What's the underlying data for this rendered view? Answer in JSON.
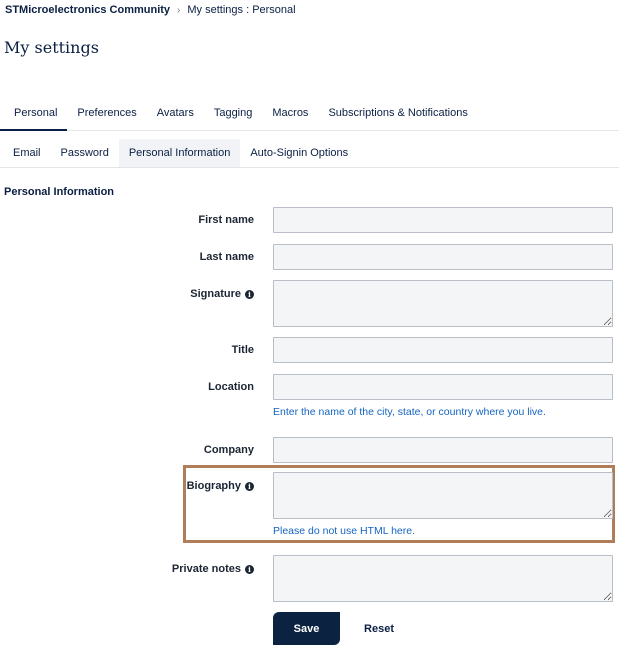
{
  "breadcrumb": {
    "root": "STMicroelectronics Community",
    "separator": "›",
    "current": "My settings : Personal"
  },
  "page_title": "My settings",
  "main_tabs": [
    {
      "label": "Personal",
      "active": true
    },
    {
      "label": "Preferences",
      "active": false
    },
    {
      "label": "Avatars",
      "active": false
    },
    {
      "label": "Tagging",
      "active": false
    },
    {
      "label": "Macros",
      "active": false
    },
    {
      "label": "Subscriptions & Notifications",
      "active": false
    }
  ],
  "sub_tabs": [
    {
      "label": "Email",
      "active": false
    },
    {
      "label": "Password",
      "active": false
    },
    {
      "label": "Personal Information",
      "active": true
    },
    {
      "label": "Auto-Signin Options",
      "active": false
    }
  ],
  "section_title": "Personal Information",
  "fields": {
    "first_name": {
      "label": "First name",
      "value": ""
    },
    "last_name": {
      "label": "Last name",
      "value": ""
    },
    "signature": {
      "label": "Signature",
      "value": "",
      "info_icon": "info-icon"
    },
    "title": {
      "label": "Title",
      "value": ""
    },
    "location": {
      "label": "Location",
      "value": "",
      "help": "Enter the name of the city, state, or country where you live."
    },
    "company": {
      "label": "Company",
      "value": ""
    },
    "biography": {
      "label": "Biography",
      "value": "",
      "info_icon": "info-icon",
      "help": "Please do not use HTML here."
    },
    "private_notes": {
      "label": "Private notes",
      "value": "",
      "info_icon": "info-icon"
    }
  },
  "buttons": {
    "save": "Save",
    "reset": "Reset"
  },
  "colors": {
    "primary": "#0b2240",
    "link": "#1565c0",
    "highlight": "#b07d5b",
    "input_bg": "#f4f5f7"
  }
}
